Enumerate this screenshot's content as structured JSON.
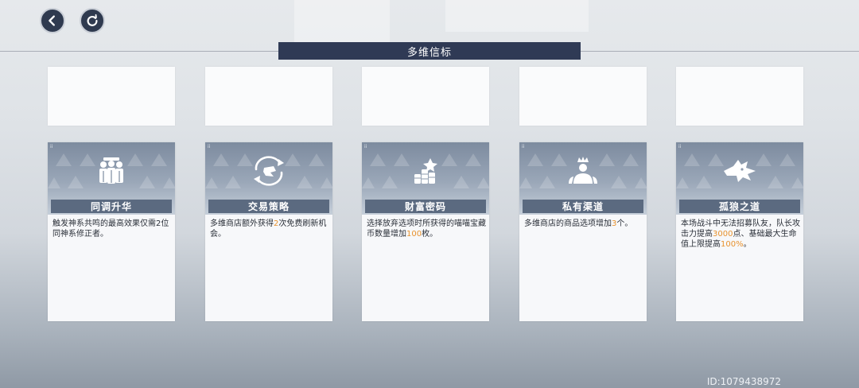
{
  "header": {
    "title": "多维信标",
    "back_icon": "back-arrow-icon",
    "refresh_icon": "refresh-icon"
  },
  "cards": [
    {
      "name": "同调升华",
      "icon": "figures-group-icon",
      "desc": [
        {
          "text": "触发神系共鸣的最高效果仅需2位同神系修正者。",
          "hl": false
        }
      ]
    },
    {
      "name": "交易策略",
      "icon": "dragon-exchange-icon",
      "desc": [
        {
          "text": "多维商店额外获得",
          "hl": false
        },
        {
          "text": "2",
          "hl": true
        },
        {
          "text": "次免费刷新机会。",
          "hl": false
        }
      ]
    },
    {
      "name": "财富密码",
      "icon": "coin-stacks-icon",
      "desc": [
        {
          "text": "选择放弃选项时所获得的喵喵宝藏币数量增加",
          "hl": false
        },
        {
          "text": "100",
          "hl": true
        },
        {
          "text": "枚。",
          "hl": false
        }
      ]
    },
    {
      "name": "私有渠道",
      "icon": "crowned-person-icon",
      "desc": [
        {
          "text": "多维商店的商品选项增加",
          "hl": false
        },
        {
          "text": "3",
          "hl": true
        },
        {
          "text": "个。",
          "hl": false
        }
      ]
    },
    {
      "name": "孤狼之道",
      "icon": "wolf-head-icon",
      "desc": [
        {
          "text": "本场战斗中无法招募队友，队长攻击力提高",
          "hl": false
        },
        {
          "text": "3000",
          "hl": true
        },
        {
          "text": "点、基础最大生命值上限提高",
          "hl": false
        },
        {
          "text": "100%",
          "hl": true
        },
        {
          "text": "。",
          "hl": false
        }
      ]
    }
  ],
  "footer": {
    "id_text": "ID:1079438972"
  },
  "colors": {
    "title_bg": "#2f3a55",
    "name_bg": "#5b6a80",
    "highlight": "#e8922e"
  }
}
